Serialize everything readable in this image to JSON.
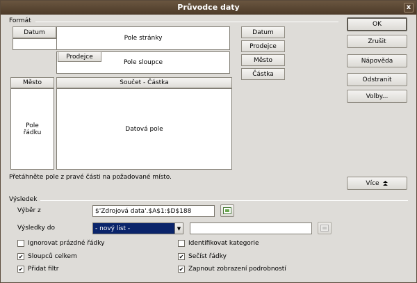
{
  "window": {
    "title": "Průvodce daty",
    "close_glyph": "x"
  },
  "format": {
    "section_label": "Formát",
    "page_field_button": "Datum",
    "page_area_label": "Pole stránky",
    "column_field_button": "Prodejce",
    "column_area_label": "Pole sloupce",
    "row_field_button": "Město",
    "row_area_label": "Pole řádku",
    "data_field_button": "Součet - Částka",
    "data_area_label": "Datová pole",
    "available_fields": [
      "Datum",
      "Prodejce",
      "Město",
      "Částka"
    ],
    "hint": "Přetáhněte pole z pravé části na požadované místo."
  },
  "buttons": {
    "ok": "OK",
    "cancel": "Zrušit",
    "help": "Nápověda",
    "remove": "Odstranit",
    "options": "Volby...",
    "more": "Více"
  },
  "result": {
    "section_label": "Výsledek",
    "selection_label": "Výběr z",
    "selection_value": "$'Zdrojová data'.$A$1:$D$188",
    "results_label": "Výsledky do",
    "results_select_value": "- nový list -",
    "results_input_value": ""
  },
  "options": {
    "ignore_empty_rows": {
      "label": "Ignorovat prázdné řádky",
      "checked": false
    },
    "identify_categories": {
      "label": "Identifikovat kategorie",
      "checked": false
    },
    "total_columns": {
      "label": "Sloupců celkem",
      "checked": true
    },
    "total_rows": {
      "label": "Sečíst řádky",
      "checked": true
    },
    "add_filter": {
      "label": "Přidat filtr",
      "checked": true
    },
    "enable_drill": {
      "label": "Zapnout zobrazení podrobností",
      "checked": true
    }
  },
  "icons": {
    "close": "close-icon",
    "shrink": "shrink-icon",
    "more": "double-chevron-up-icon",
    "dropdown": "chevron-down-icon"
  }
}
